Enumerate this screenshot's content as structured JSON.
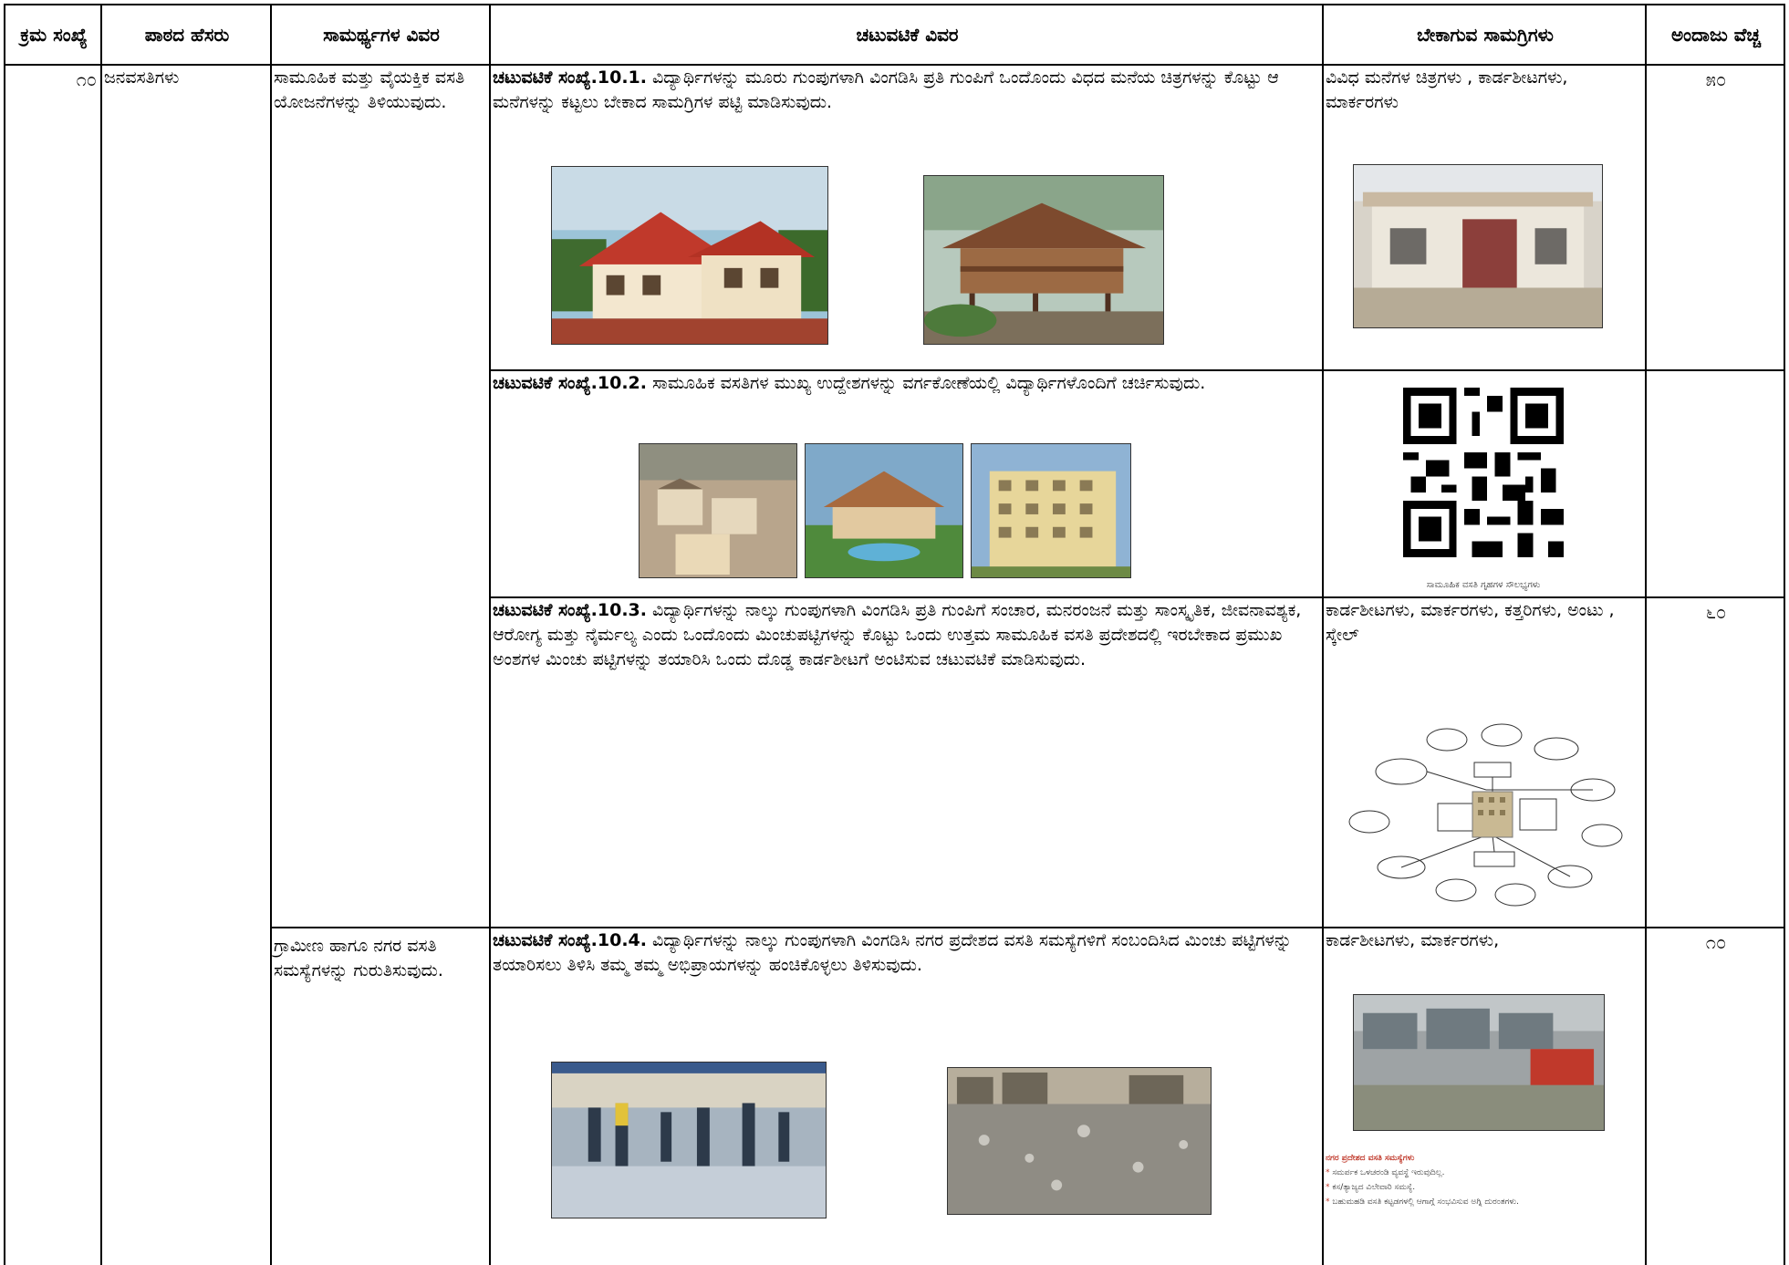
{
  "headers": {
    "sl_no": "ಕ್ರಮ ಸಂಖ್ಯೆ",
    "lesson_name": "ಪಾಠದ ಹೆಸರು",
    "competency": "ಸಾಮರ್ಥ್ಯಗಳ ವಿವರ",
    "activity": "ಚಟುವಟಿಕೆ ವಿವರ",
    "materials": "ಬೇಕಾಗುವ ಸಾಮಗ್ರಿಗಳು",
    "cost": "ಅಂದಾಜು ವೆಚ್ಚ"
  },
  "row": {
    "sl_no": "೧೦",
    "lesson_name": "ಜನವಸತಿಗಳು"
  },
  "competencies": [
    "ಸಾಮೂಹಿಕ ಮತ್ತು ವೈಯಕ್ತಿಕ ವಸತಿ ಯೋಜನೆಗಳನ್ನು ತಿಳಿಯುವುದು.",
    "ಗ್ರಾಮೀಣ ಹಾಗೂ ನಗರ ವಸತಿ ಸಮಸ್ಯೆಗಳನ್ನು ಗುರುತಿಸುವುದು."
  ],
  "activities": [
    {
      "label": "ಚಟುವಟಿಕೆ ಸಂಖ್ಯೆ.10.1.",
      "text": " ವಿದ್ಯಾರ್ಥಿಗಳನ್ನು  ಮೂರು ಗುಂಪುಗಳಾಗಿ ವಿಂಗಡಿಸಿ ಪ್ರತಿ ಗುಂಪಿಗೆ ಒಂದೊಂದು ವಿಧದ ಮನೆಯ ಚಿತ್ರಗಳನ್ನು ಕೊಟ್ಟು ಆ ಮನೆಗಳನ್ನು ಕಟ್ಟಲು ಬೇಕಾದ ಸಾಮಗ್ರಿಗಳ ಪಟ್ಟಿ ಮಾಡಿಸುವುದು.",
      "materials": "ವಿವಿಧ ಮನೆಗಳ ಚಿತ್ರಗಳು , ಕಾರ್ಡಶೀಟಗಳು, ಮಾರ್ಕರಗಳು",
      "cost": "೫೦"
    },
    {
      "label": "ಚಟುವಟಿಕೆ ಸಂಖ್ಯೆ.10.2.",
      "text": "  ಸಾಮೂಹಿಕ ವಸತಿಗಳ ಮುಖ್ಯ ಉದ್ದೇಶಗಳನ್ನು ವರ್ಗಕೋಣೆಯಲ್ಲಿ ವಿದ್ಯಾರ್ಥಿಗಳೊಂದಿಗೆ  ಚರ್ಚಿಸುವುದು.",
      "qr_caption": "ಸಾಮೂಹಿಕ ವಸತಿ ಗೃಹಗಳ ಸೌಲಭ್ಯಗಳು"
    },
    {
      "label": "ಚಟುವಟಿಕೆ ಸಂಖ್ಯೆ.10.3.",
      "text": " ವಿದ್ಯಾರ್ಥಿಗಳನ್ನು  ನಾಲ್ಕು ಗುಂಪುಗಳಾಗಿ ವಿಂಗಡಿಸಿ ಪ್ರತಿ ಗುಂಪಿಗೆ ಸಂಚಾರ, ಮನರಂಜನೆ ಮತ್ತು ಸಾಂಸ್ಕೃತಿಕ, ಜೀವನಾವಶ್ಯಕ, ಆರೋಗ್ಯ ಮತ್ತು ನೈರ್ಮಲ್ಯ ಎಂದು ಒಂದೊಂದು  ಮಿಂಚುಪಟ್ಟಿಗಳನ್ನು ಕೊಟ್ಟು ಒಂದು ಉತ್ತಮ ಸಾಮೂಹಿಕ ವಸತಿ ಪ್ರದೇಶದಲ್ಲಿ ಇರಬೇಕಾದ ಪ್ರಮುಖ ಅಂಶಗಳ ಮಿಂಚು ಪಟ್ಟಿಗಳನ್ನು ತಯಾರಿಸಿ ಒಂದು ದೊಡ್ಡ ಕಾರ್ಡಶೀಟಗೆ ಅಂಟಿಸುವ ಚಟುವಟಿಕೆ ಮಾಡಿಸುವುದು.",
      "materials": "ಕಾರ್ಡಶೀಟಗಳು, ಮಾರ್ಕರಗಳು, ಕತ್ತರಿಗಳು, ಅಂಟು , ಸ್ಕೇಲ್",
      "cost": "೬೦"
    },
    {
      "label": "ಚಟುವಟಿಕೆ ಸಂಖ್ಯೆ.10.4.",
      "text": " ವಿದ್ಯಾರ್ಥಿಗಳನ್ನು ನಾಲ್ಕು ಗುಂಪುಗಳಾಗಿ ವಿಂಗಡಿಸಿ ನಗರ ಪ್ರದೇಶದ  ವಸತಿ ಸಮಸ್ಯೆಗಳಿಗೆ ಸಂಬಂದಿಸಿದ ಮಿಂಚು ಪಟ್ಟಿಗಳನ್ನು ತಯಾರಿಸಲು ತಿಳಿಸಿ ತಮ್ಮ ತಮ್ಮ ಅಭಿಪ್ರಾಯಗಳನ್ನು ಹಂಚಿಕೊಳ್ಳಲು ತಿಳಿಸುವುದು.",
      "materials": "ಕಾರ್ಡಶೀಟಗಳು, ಮಾರ್ಕರಗಳು,",
      "cost": "೧೦"
    }
  ],
  "slum_card": {
    "title": "ನಗರ ಪ್ರದೇಶದ ವಸತಿ ಸಮಸ್ಯೆಗಳು",
    "points": [
      "ಸಮರ್ಪಕ ಒಳಚರಂಡಿ ವ್ಯವಸ್ಥೆ ಇರುವುದಿಲ್ಲ.",
      "ಕಸ/ತ್ಯಾಜ್ಯದ ವಿಲೇವಾರಿ ಸಮಸ್ಯೆ.",
      "ಬಹುಮಹಡಿ ವಸತಿ ಕಟ್ಟಡಗಳಲ್ಲಿ ಆಗಾಗ್ಗೆ ಸಂಭವಿಸುವ ಅಗ್ನಿ ದುರಂತಗಳು."
    ]
  },
  "colors": {
    "border": "#000000",
    "roof_red": "#c0392b",
    "slum_heading": "#c0392b"
  }
}
